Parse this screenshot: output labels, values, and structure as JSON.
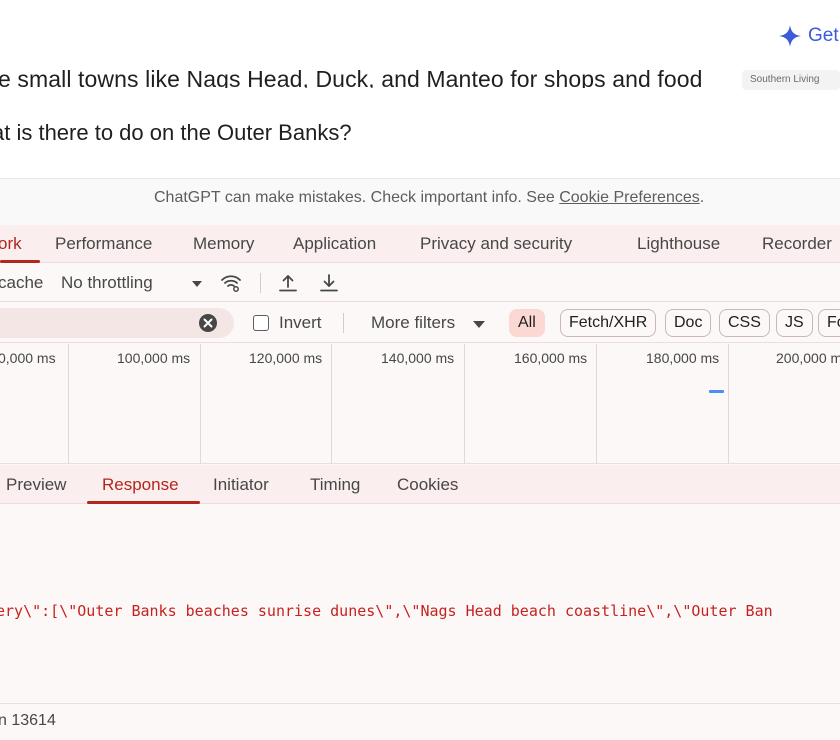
{
  "chat": {
    "get_button_label": "Get",
    "clipped_line": "e small towns like Nags Head, Duck, and Manteo for shops and food",
    "source_chip": "Southern Living",
    "question": "at is there to do on the Outer Banks?",
    "disclaimer_prefix": "ChatGPT can make mistakes. Check important info. See ",
    "disclaimer_link": "Cookie Preferences",
    "disclaimer_suffix": "."
  },
  "devtools": {
    "tabs": [
      {
        "label": "ork",
        "active": true
      },
      {
        "label": "Performance"
      },
      {
        "label": "Memory"
      },
      {
        "label": "Application"
      },
      {
        "label": "Privacy and security"
      },
      {
        "label": "Lighthouse"
      },
      {
        "label": "Recorder"
      }
    ],
    "toolbar": {
      "cache_label": "cache",
      "throttling_label": "No throttling"
    },
    "filterbar": {
      "invert_label": "Invert",
      "more_filters_label": "More filters",
      "chips": [
        "All",
        "Fetch/XHR",
        "Doc",
        "CSS",
        "JS",
        "Fo"
      ]
    },
    "timeline": {
      "labels": [
        "0,000 ms",
        "100,000 ms",
        "120,000 ms",
        "140,000 ms",
        "160,000 ms",
        "180,000 ms",
        "200,000 ms"
      ]
    },
    "subtabs": [
      {
        "label": "Preview"
      },
      {
        "label": "Response",
        "active": true
      },
      {
        "label": "Initiator"
      },
      {
        "label": "Timing"
      },
      {
        "label": "Cookies"
      }
    ],
    "response_line": "ery\\\":[\\\"Outer Banks beaches sunrise dunes\\\",\\\"Nags Head beach coastline\\\",\\\"Outer Ban",
    "status_text": "n 13614"
  },
  "colors": {
    "accent_red": "#b3261e",
    "link_blue": "#3b5bdb",
    "timeline_bar": "#4c8df6"
  }
}
